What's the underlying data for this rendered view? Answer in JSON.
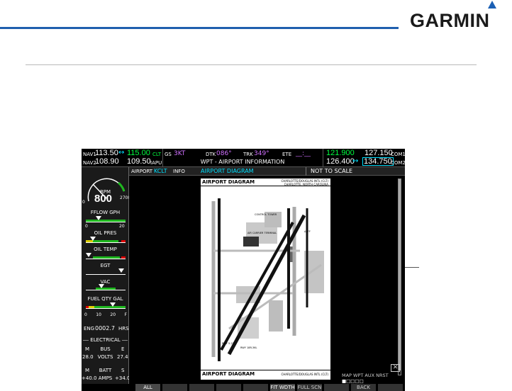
{
  "header": {
    "logo": "GARMIN"
  },
  "topbar": {
    "nav1_label": "NAV1",
    "nav1_standby": "113.50",
    "nav1_active": "115.00",
    "nav1_ident": "CLT",
    "nav2_label": "NAV2",
    "nav2_standby": "108.90",
    "nav2_active": "109.50",
    "nav2_ident": "IAPU",
    "gs_label": "GS",
    "gs_value": "3KT",
    "dtk_label": "DTK",
    "dtk_value": "086°",
    "trk_label": "TRK",
    "trk_value": "349°",
    "ete_label": "ETE",
    "ete_value": "__:__",
    "page_title": "WPT - AIRPORT INFORMATION",
    "com1_active": "121.900",
    "com1_standby": "127.150",
    "com1_label": "COM1",
    "com2_active": "126.400",
    "com2_standby": "134.750",
    "com2_label": "COM2"
  },
  "eis": {
    "rpm_label": "RPM",
    "rpm_value": "800",
    "rpm_max": "2700",
    "rpm_min": "0",
    "fflow_label": "FFLOW GPH",
    "fflow_min": "0",
    "fflow_max": "20",
    "oil_pres_label": "OIL PRES",
    "oil_temp_label": "OIL TEMP",
    "egt_label": "EGT",
    "vac_label": "VAC",
    "fuel_label": "FUEL QTY GAL",
    "fuel_ticks": [
      "0",
      "10",
      "20",
      "F"
    ],
    "eng_label": "ENG",
    "eng_value": "0002.7",
    "eng_unit": "HRS",
    "electrical_label": "ELECTRICAL",
    "bus_label": "BUS",
    "bus_m": "M",
    "bus_e": "E",
    "volts_m": "28.0",
    "volts_label": "VOLTS",
    "volts_e": "27.4",
    "batt_label": "BATT",
    "batt_m": "M",
    "batt_s": "S",
    "amps_m": "+40.0",
    "amps_label": "AMPS",
    "amps_s": "+34.0"
  },
  "infobar": {
    "airport_label": "AIRPORT",
    "airport_ident": "KCLT",
    "info_label": "INFO",
    "title": "AIRPORT DIAGRAM",
    "note": "NOT TO SCALE"
  },
  "diagram": {
    "title_top": "AIRPORT DIAGRAM",
    "title_bottom": "AIRPORT DIAGRAM",
    "airport_name": "CHARLOTTE/DOUGLAS INTL (CLT)",
    "city": "CHARLOTTE, NORTH CAROLINA"
  },
  "mapwpt": "MAP WPT AUX NRST",
  "softkeys": [
    "ALL",
    "",
    "",
    "",
    "",
    "FIT WDTH",
    "FULL SCN",
    "",
    "BACK",
    ""
  ]
}
